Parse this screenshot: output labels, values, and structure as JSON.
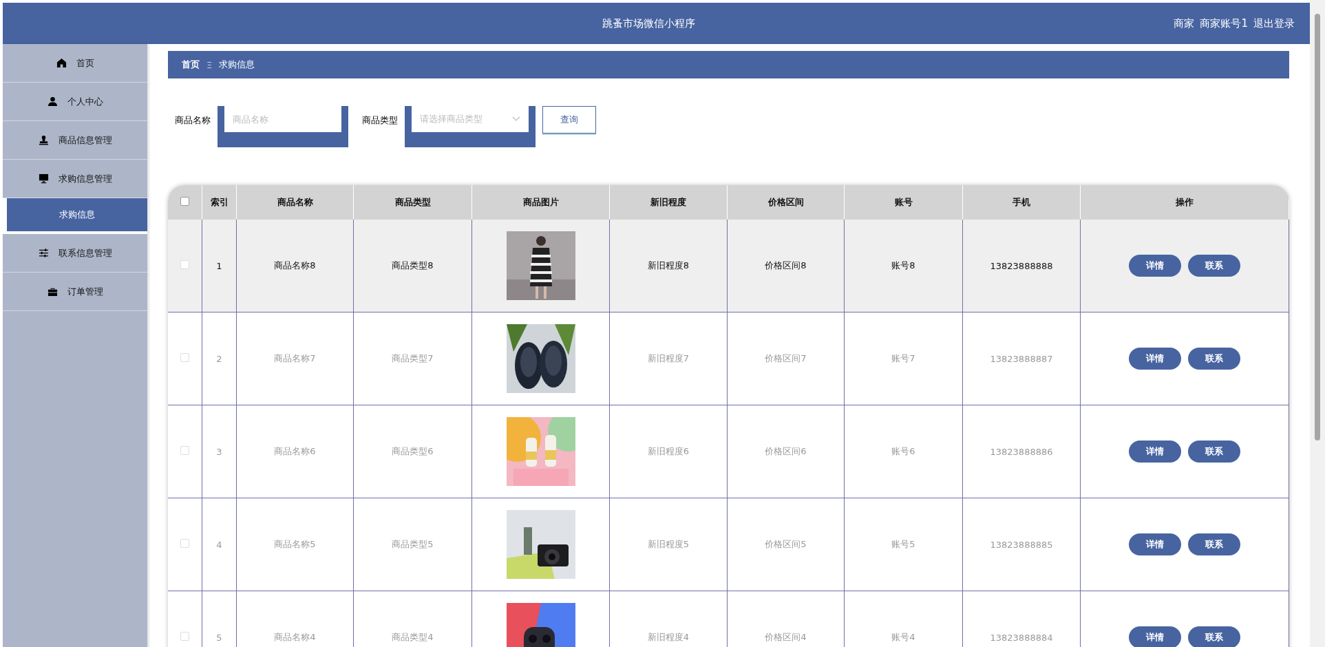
{
  "header": {
    "title": "跳蚤市场微信小程序",
    "user_role": "商家",
    "username": "商家账号1",
    "logout": "退出登录"
  },
  "sidebar": {
    "items": [
      {
        "label": "首页",
        "selected": false
      },
      {
        "label": "个人中心",
        "selected": false
      },
      {
        "label": "商品信息管理",
        "selected": false
      },
      {
        "label": "求购信息管理",
        "selected": false,
        "children": [
          {
            "label": "求购信息",
            "selected": true
          }
        ]
      },
      {
        "label": "联系信息管理",
        "selected": false
      },
      {
        "label": "订单管理",
        "selected": false
      }
    ]
  },
  "breadcrumb": {
    "home": "首页",
    "separator": "Ξ",
    "current": "求购信息"
  },
  "search": {
    "name_label": "商品名称",
    "name_placeholder": "商品名称",
    "type_label": "商品类型",
    "type_placeholder": "请选择商品类型",
    "button": "查询"
  },
  "table": {
    "select_all_checked": false,
    "columns": [
      "索引",
      "商品名称",
      "商品类型",
      "商品图片",
      "新旧程度",
      "价格区间",
      "账号",
      "手机",
      "操作"
    ],
    "rows": [
      {
        "index": "1",
        "name": "商品名称8",
        "type": "商品类型8",
        "condition": "新旧程度8",
        "price": "价格区间8",
        "account": "账号8",
        "phone": "13823888888",
        "highlighted": true,
        "checked": false,
        "actions": [
          "详情",
          "联系"
        ]
      },
      {
        "index": "2",
        "name": "商品名称7",
        "type": "商品类型7",
        "condition": "新旧程度7",
        "price": "价格区间7",
        "account": "账号7",
        "phone": "13823888887",
        "highlighted": false,
        "checked": false,
        "actions": [
          "详情",
          "联系"
        ]
      },
      {
        "index": "3",
        "name": "商品名称6",
        "type": "商品类型6",
        "condition": "新旧程度6",
        "price": "价格区间6",
        "account": "账号6",
        "phone": "13823888886",
        "highlighted": false,
        "checked": false,
        "actions": [
          "详情",
          "联系"
        ]
      },
      {
        "index": "4",
        "name": "商品名称5",
        "type": "商品类型5",
        "condition": "新旧程度5",
        "price": "价格区间5",
        "account": "账号5",
        "phone": "13823888885",
        "highlighted": false,
        "checked": false,
        "actions": [
          "详情",
          "联系"
        ]
      },
      {
        "index": "5",
        "name": "商品名称4",
        "type": "商品类型4",
        "condition": "新旧程度4",
        "price": "价格区间4",
        "account": "账号4",
        "phone": "13823888884",
        "highlighted": false,
        "checked": false,
        "actions": [
          "详情",
          "联系"
        ]
      }
    ]
  }
}
